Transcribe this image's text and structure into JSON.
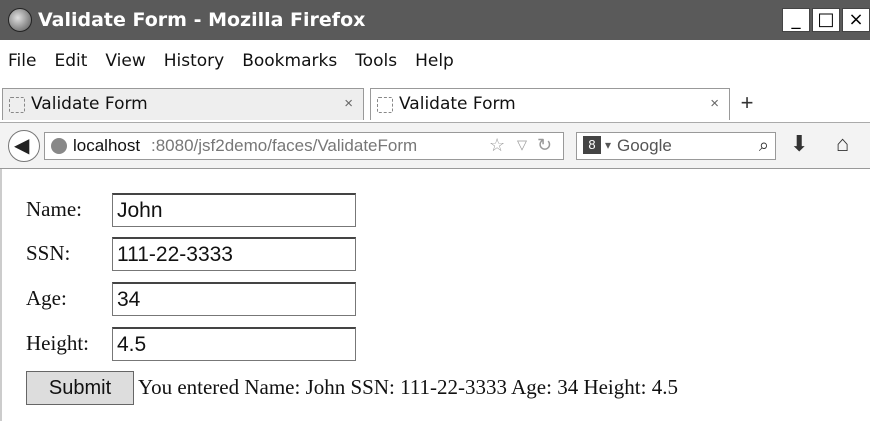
{
  "window": {
    "title": "Validate Form - Mozilla Firefox",
    "controls": {
      "minimize": "_",
      "maximize": "□",
      "close": "×"
    }
  },
  "menu": [
    "File",
    "Edit",
    "View",
    "History",
    "Bookmarks",
    "Tools",
    "Help"
  ],
  "tabs": [
    {
      "label": "Validate Form",
      "close": "×",
      "active": false
    },
    {
      "label": "Validate Form",
      "close": "×",
      "active": true
    }
  ],
  "new_tab": "+",
  "nav": {
    "url_host": "localhost",
    "url_path": ":8080/jsf2demo/faces/ValidateForm",
    "search_engine": "8",
    "search_placeholder": "Google",
    "icons": [
      "back-icon",
      "globe-icon",
      "star-icon",
      "dropdown-icon",
      "reload-icon",
      "search-icon",
      "download-icon",
      "home-icon"
    ]
  },
  "form": {
    "name": {
      "label": "Name:",
      "value": "John"
    },
    "ssn": {
      "label": "SSN:",
      "value": "111-22-3333"
    },
    "age": {
      "label": "Age:",
      "value": "34"
    },
    "height": {
      "label": "Height:",
      "value": "4.5"
    },
    "submit_label": "Submit",
    "result": "You entered Name: John SSN: 111-22-3333 Age: 34 Height: 4.5"
  }
}
